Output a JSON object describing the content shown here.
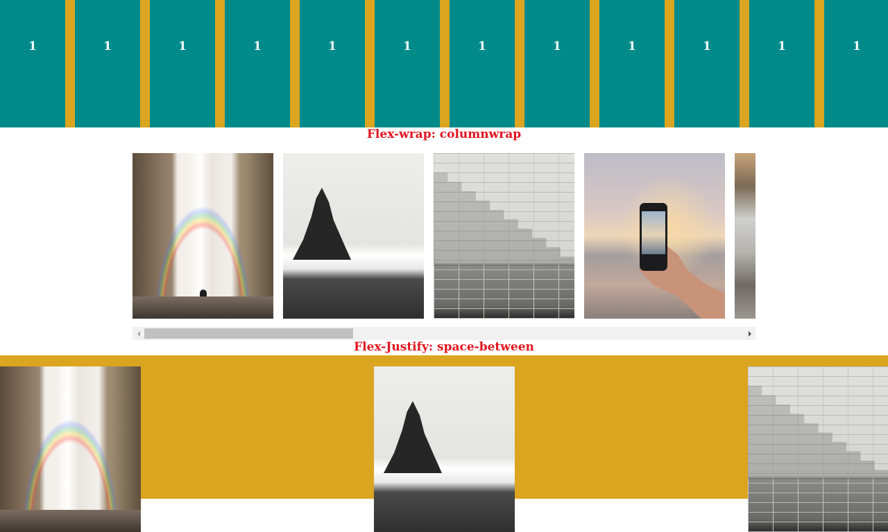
{
  "boxes": [
    "1",
    "1",
    "1",
    "1",
    "1",
    "1",
    "1",
    "1",
    "1",
    "1",
    "1",
    "1"
  ],
  "headings": {
    "wrap": "Flex-wrap: columnwrap",
    "justify": "Flex-Justify: space-between"
  },
  "gallery": {
    "images": [
      "waterfall-image",
      "sea-stack-image",
      "stairs-image",
      "phone-photo-image",
      "coast-image"
    ]
  },
  "colors": {
    "box_teal": "#008b8a",
    "background_gold": "#dba520",
    "heading_red": "#e0141e"
  },
  "scrollbar": {
    "thumb_position": 0.0
  }
}
